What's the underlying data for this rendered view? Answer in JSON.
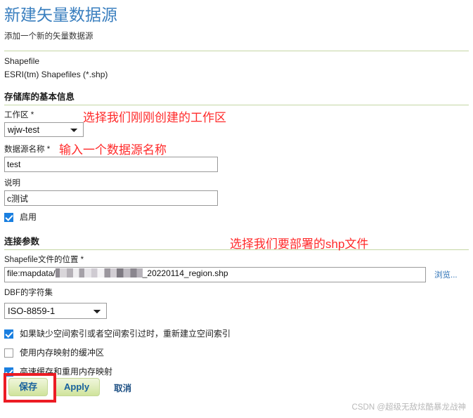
{
  "header": {
    "title": "新建矢量数据源",
    "subtitle": "添加一个新的矢量数据源"
  },
  "store_type": {
    "name": "Shapefile",
    "description": "ESRI(tm) Shapefiles (*.shp)"
  },
  "basic_section": {
    "heading": "存储库的基本信息",
    "workspace": {
      "label": "工作区 *",
      "value": "wjw-test",
      "options": [
        "wjw-test"
      ]
    },
    "datasource_name": {
      "label": "数据源名称 *",
      "value": "test",
      "placeholder": ""
    },
    "description": {
      "label": "说明",
      "value": "c测试",
      "placeholder": ""
    },
    "enabled": {
      "label": "启用",
      "checked": true
    }
  },
  "connection_section": {
    "heading": "连接参数",
    "file_location": {
      "label": "Shapefile文件的位置 *",
      "value_prefix": "file:mapdata/",
      "value_redacted": "[已打码]",
      "value_suffix": "_20220114_region.shp",
      "browse_label": "浏览..."
    },
    "dbf_charset": {
      "label": "DBF的字符集",
      "value": "ISO-8859-1",
      "options": [
        "ISO-8859-1"
      ]
    },
    "options": [
      {
        "label": "如果缺少空间索引或者空间索引过时，重新建立空间索引",
        "checked": true
      },
      {
        "label": "使用内存映射的缓冲区",
        "checked": false
      },
      {
        "label": "高速缓存和重用内存映射",
        "checked": true
      }
    ]
  },
  "buttons": {
    "save": "保存",
    "apply": "Apply",
    "cancel": "取消"
  },
  "annotations": [
    {
      "text": "选择我们刚刚创建的工作区"
    },
    {
      "text": "输入一个数据源名称"
    },
    {
      "text": "选择我们要部署的shp文件"
    }
  ],
  "watermark": "CSDN @超级无敌炫酷暴龙战神",
  "colors": {
    "title": "#3a7fbf",
    "rule": "#c4d6a4",
    "annotation": "#ff2a2a",
    "highlight_box": "#ec1c24",
    "checkbox_checked": "#1a7fe0",
    "button_text": "#17609e",
    "link": "#2a6fb5"
  }
}
